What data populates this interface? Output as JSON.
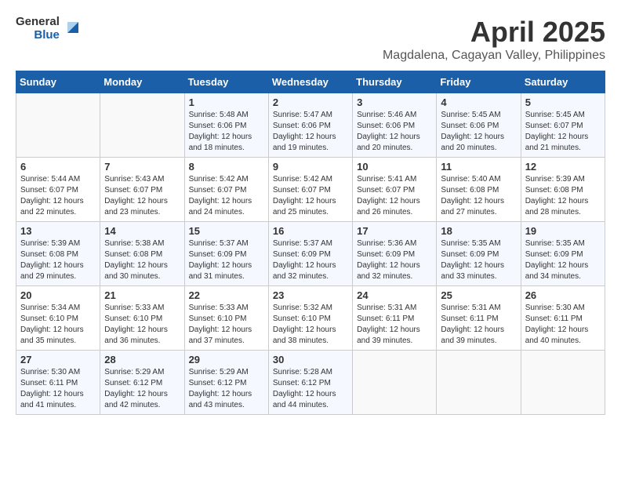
{
  "logo": {
    "general": "General",
    "blue": "Blue"
  },
  "title": "April 2025",
  "subtitle": "Magdalena, Cagayan Valley, Philippines",
  "weekdays": [
    "Sunday",
    "Monday",
    "Tuesday",
    "Wednesday",
    "Thursday",
    "Friday",
    "Saturday"
  ],
  "weeks": [
    [
      {
        "day": "",
        "info": ""
      },
      {
        "day": "",
        "info": ""
      },
      {
        "day": "1",
        "info": "Sunrise: 5:48 AM\nSunset: 6:06 PM\nDaylight: 12 hours\nand 18 minutes."
      },
      {
        "day": "2",
        "info": "Sunrise: 5:47 AM\nSunset: 6:06 PM\nDaylight: 12 hours\nand 19 minutes."
      },
      {
        "day": "3",
        "info": "Sunrise: 5:46 AM\nSunset: 6:06 PM\nDaylight: 12 hours\nand 20 minutes."
      },
      {
        "day": "4",
        "info": "Sunrise: 5:45 AM\nSunset: 6:06 PM\nDaylight: 12 hours\nand 20 minutes."
      },
      {
        "day": "5",
        "info": "Sunrise: 5:45 AM\nSunset: 6:07 PM\nDaylight: 12 hours\nand 21 minutes."
      }
    ],
    [
      {
        "day": "6",
        "info": "Sunrise: 5:44 AM\nSunset: 6:07 PM\nDaylight: 12 hours\nand 22 minutes."
      },
      {
        "day": "7",
        "info": "Sunrise: 5:43 AM\nSunset: 6:07 PM\nDaylight: 12 hours\nand 23 minutes."
      },
      {
        "day": "8",
        "info": "Sunrise: 5:42 AM\nSunset: 6:07 PM\nDaylight: 12 hours\nand 24 minutes."
      },
      {
        "day": "9",
        "info": "Sunrise: 5:42 AM\nSunset: 6:07 PM\nDaylight: 12 hours\nand 25 minutes."
      },
      {
        "day": "10",
        "info": "Sunrise: 5:41 AM\nSunset: 6:07 PM\nDaylight: 12 hours\nand 26 minutes."
      },
      {
        "day": "11",
        "info": "Sunrise: 5:40 AM\nSunset: 6:08 PM\nDaylight: 12 hours\nand 27 minutes."
      },
      {
        "day": "12",
        "info": "Sunrise: 5:39 AM\nSunset: 6:08 PM\nDaylight: 12 hours\nand 28 minutes."
      }
    ],
    [
      {
        "day": "13",
        "info": "Sunrise: 5:39 AM\nSunset: 6:08 PM\nDaylight: 12 hours\nand 29 minutes."
      },
      {
        "day": "14",
        "info": "Sunrise: 5:38 AM\nSunset: 6:08 PM\nDaylight: 12 hours\nand 30 minutes."
      },
      {
        "day": "15",
        "info": "Sunrise: 5:37 AM\nSunset: 6:09 PM\nDaylight: 12 hours\nand 31 minutes."
      },
      {
        "day": "16",
        "info": "Sunrise: 5:37 AM\nSunset: 6:09 PM\nDaylight: 12 hours\nand 32 minutes."
      },
      {
        "day": "17",
        "info": "Sunrise: 5:36 AM\nSunset: 6:09 PM\nDaylight: 12 hours\nand 32 minutes."
      },
      {
        "day": "18",
        "info": "Sunrise: 5:35 AM\nSunset: 6:09 PM\nDaylight: 12 hours\nand 33 minutes."
      },
      {
        "day": "19",
        "info": "Sunrise: 5:35 AM\nSunset: 6:09 PM\nDaylight: 12 hours\nand 34 minutes."
      }
    ],
    [
      {
        "day": "20",
        "info": "Sunrise: 5:34 AM\nSunset: 6:10 PM\nDaylight: 12 hours\nand 35 minutes."
      },
      {
        "day": "21",
        "info": "Sunrise: 5:33 AM\nSunset: 6:10 PM\nDaylight: 12 hours\nand 36 minutes."
      },
      {
        "day": "22",
        "info": "Sunrise: 5:33 AM\nSunset: 6:10 PM\nDaylight: 12 hours\nand 37 minutes."
      },
      {
        "day": "23",
        "info": "Sunrise: 5:32 AM\nSunset: 6:10 PM\nDaylight: 12 hours\nand 38 minutes."
      },
      {
        "day": "24",
        "info": "Sunrise: 5:31 AM\nSunset: 6:11 PM\nDaylight: 12 hours\nand 39 minutes."
      },
      {
        "day": "25",
        "info": "Sunrise: 5:31 AM\nSunset: 6:11 PM\nDaylight: 12 hours\nand 39 minutes."
      },
      {
        "day": "26",
        "info": "Sunrise: 5:30 AM\nSunset: 6:11 PM\nDaylight: 12 hours\nand 40 minutes."
      }
    ],
    [
      {
        "day": "27",
        "info": "Sunrise: 5:30 AM\nSunset: 6:11 PM\nDaylight: 12 hours\nand 41 minutes."
      },
      {
        "day": "28",
        "info": "Sunrise: 5:29 AM\nSunset: 6:12 PM\nDaylight: 12 hours\nand 42 minutes."
      },
      {
        "day": "29",
        "info": "Sunrise: 5:29 AM\nSunset: 6:12 PM\nDaylight: 12 hours\nand 43 minutes."
      },
      {
        "day": "30",
        "info": "Sunrise: 5:28 AM\nSunset: 6:12 PM\nDaylight: 12 hours\nand 44 minutes."
      },
      {
        "day": "",
        "info": ""
      },
      {
        "day": "",
        "info": ""
      },
      {
        "day": "",
        "info": ""
      }
    ]
  ]
}
